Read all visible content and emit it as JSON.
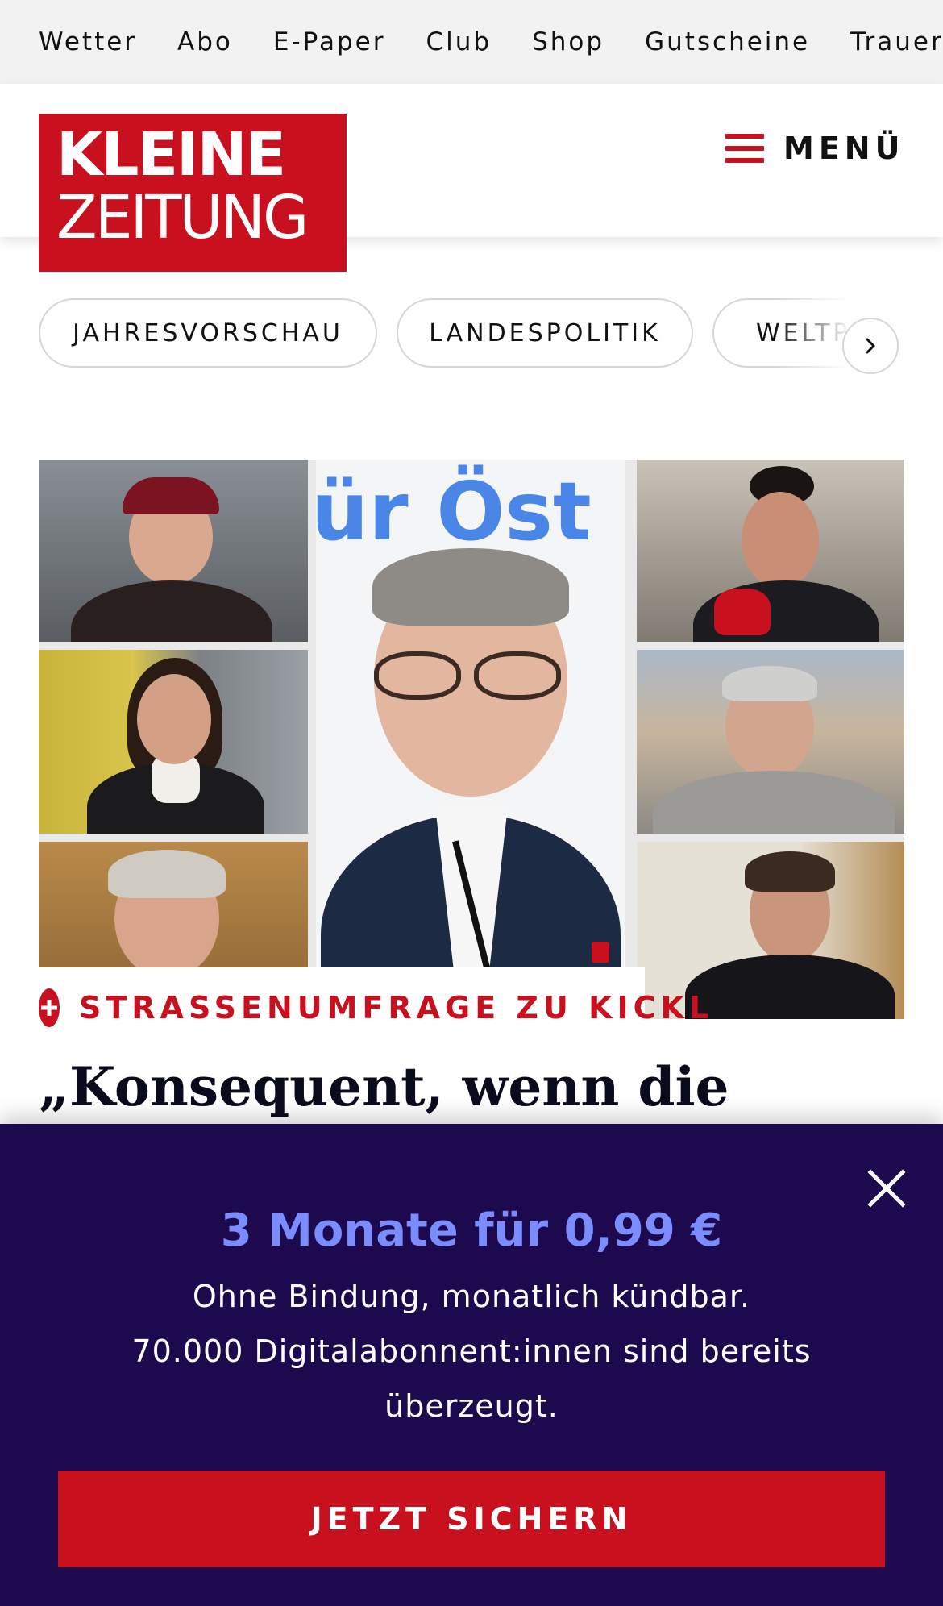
{
  "topnav": {
    "items": [
      "Wetter",
      "Abo",
      "E-Paper",
      "Club",
      "Shop",
      "Gutscheine",
      "Trauerportal"
    ]
  },
  "header": {
    "logo_line1": "KLEINE",
    "logo_line2": "ZEITUNG",
    "menu_label": "MENÜ"
  },
  "chips": {
    "items": [
      "JAHRESVORSCHAU",
      "LANDESPOLITIK",
      "WELTPOLITIK"
    ]
  },
  "hero": {
    "image_banner_text": "ür Öst"
  },
  "article": {
    "kicker": "STRASSENUMFRAGE ZU KICKL",
    "headline": "„Konsequent, wenn die"
  },
  "promo": {
    "title": "3 Monate für 0,99 €",
    "line1": "Ohne Bindung, monatlich kündbar.",
    "line2": "70.000 Digitalabonnent:innen sind bereits überzeugt.",
    "cta": "JETZT SICHERN"
  },
  "colors": {
    "brand_red": "#c8101f",
    "promo_bg": "#1d0a4e",
    "promo_accent": "#7b8cff"
  }
}
